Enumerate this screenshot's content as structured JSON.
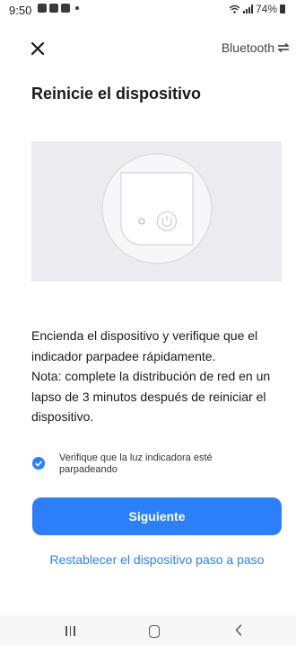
{
  "status_bar": {
    "time": "9:50",
    "battery": "74%",
    "icons": [
      "image-notification-icon",
      "app-notification-icon",
      "message-notification-icon",
      "dot-icon",
      "wifi-icon",
      "signal-icon",
      "battery-icon"
    ]
  },
  "top_bar": {
    "close_icon": "close-icon",
    "bluetooth_label": "Bluetooth",
    "switch_icon": "swap-arrows-icon"
  },
  "page": {
    "title": "Reinicie el dispositivo",
    "illustration_icons": [
      "indicator-light-icon",
      "power-button-icon"
    ],
    "description_lines": [
      "Encienda el dispositivo y verifique que el",
      "indicador parpadee rápidamente.",
      "Nota: complete la distribución de red en un",
      "lapso de 3 minutos después de reiniciar el",
      "dispositivo."
    ],
    "confirm_check": {
      "checked": true,
      "label": "Verifique que la luz indicadora esté parpadeando"
    },
    "next_button": "Siguiente",
    "reset_link": "Restablecer el dispositivo paso a paso"
  },
  "nav_bar": {
    "icons": [
      "recent-apps-icon",
      "home-icon",
      "back-icon"
    ]
  },
  "colors": {
    "accent": "#2d7ff9",
    "illustration_bg": "#ececf0",
    "device_fill": "#f9f9fb",
    "device_stroke": "#dcdce2",
    "text": "#1a1a1a"
  }
}
